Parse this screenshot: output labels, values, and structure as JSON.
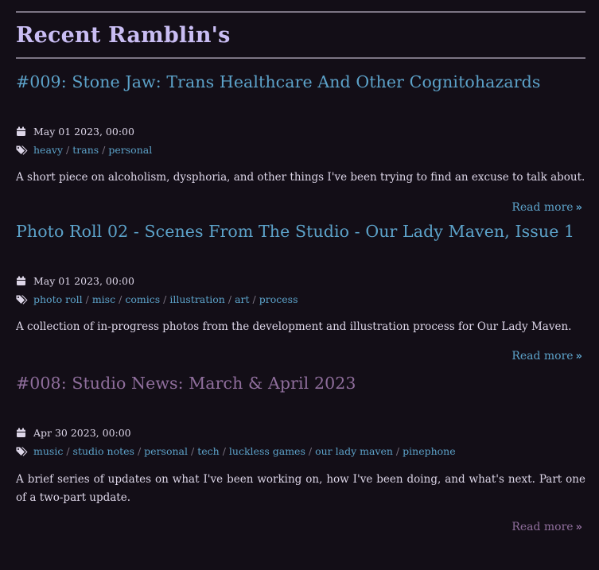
{
  "page": {
    "heading": "Recent Ramblin's"
  },
  "colors": {
    "background": "#130e17",
    "heading": "#c9bdf3",
    "link": "#5ca2c9",
    "visited_link": "#8f6e9c",
    "text": "#ddd6e8",
    "rule": "#7c7584"
  },
  "posts": [
    {
      "title": "#009: Stone Jaw: Trans Healthcare And Other Cognitohazards",
      "date": "May 01 2023, 00:00",
      "tags": [
        "heavy",
        "trans",
        "personal"
      ],
      "excerpt": "A short piece on alcoholism, dysphoria, and other things I've been trying to find an excuse to talk about.",
      "read_more": "Read more",
      "visited": false
    },
    {
      "title": "Photo Roll 02 - Scenes From The Studio - Our Lady Maven, Issue 1",
      "date": "May 01 2023, 00:00",
      "tags": [
        "photo roll",
        "misc",
        "comics",
        "illustration",
        "art",
        "process"
      ],
      "excerpt": "A collection of in-progress photos from the development and illustration process for Our Lady Maven.",
      "read_more": "Read more",
      "visited": false
    },
    {
      "title": "#008: Studio News: March & April 2023",
      "date": "Apr 30 2023, 00:00",
      "tags": [
        "music",
        "studio notes",
        "personal",
        "tech",
        "luckless games",
        "our lady maven",
        "pinephone"
      ],
      "excerpt": "A brief series of updates on what I've been working on, how I've been doing, and what's next. Part one of a two-part update.",
      "read_more": "Read more",
      "visited": true
    }
  ],
  "icons": {
    "date": "calendar-icon",
    "tags": "tags-icon",
    "read_more": "double-chevron-right-icon"
  }
}
